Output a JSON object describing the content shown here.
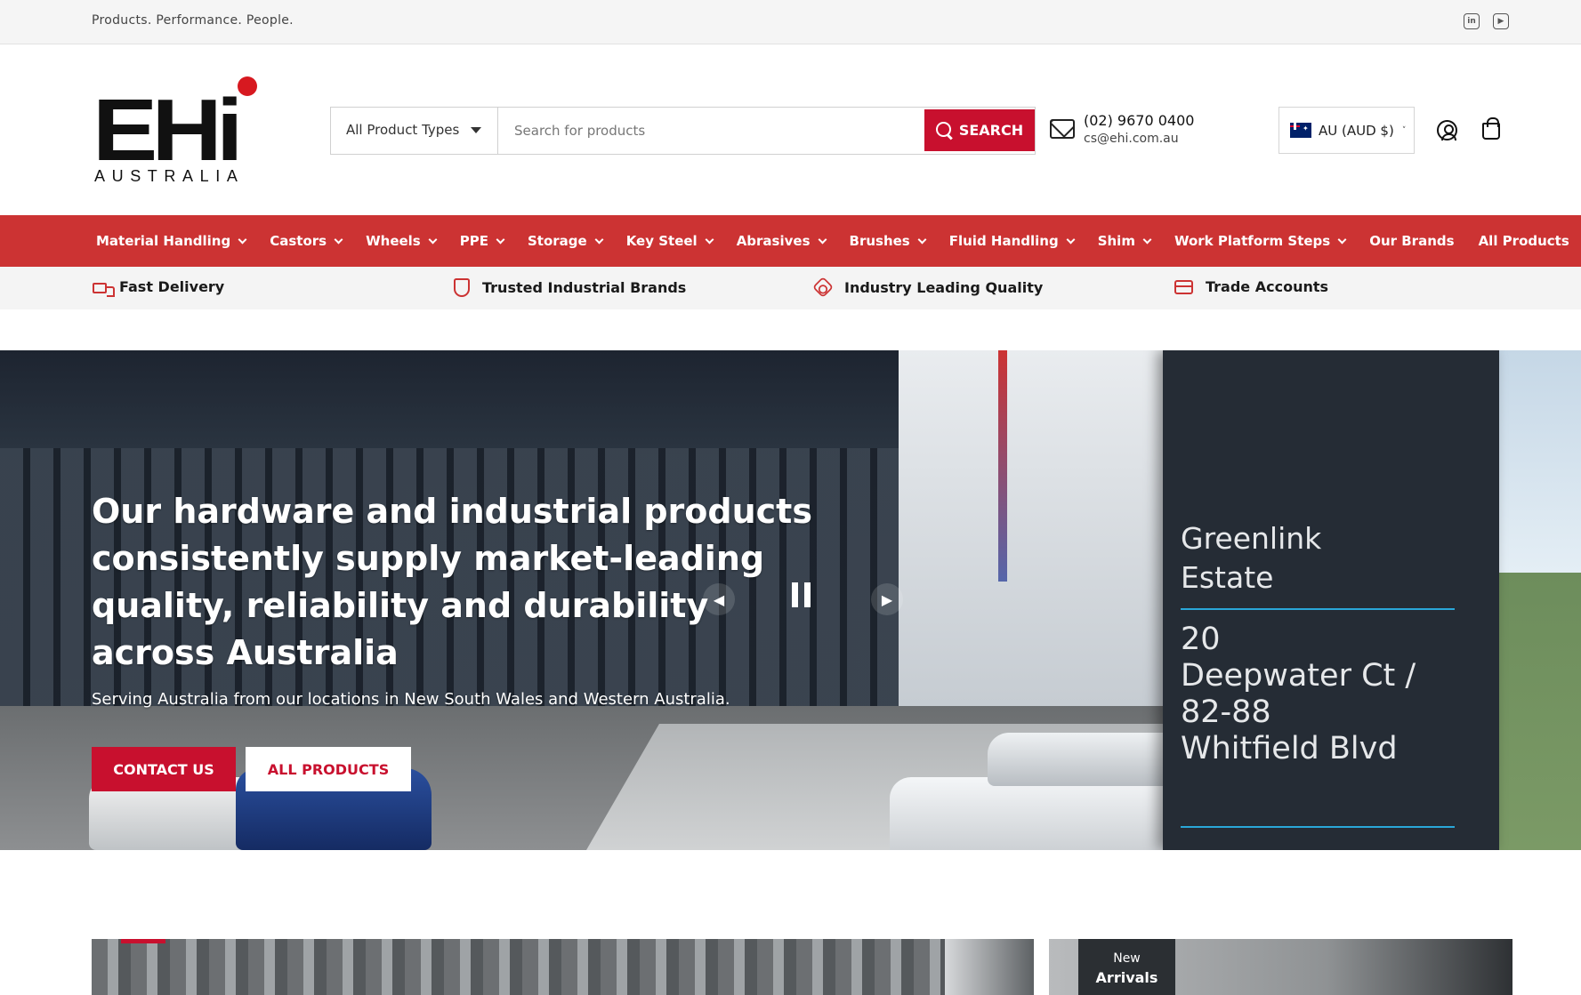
{
  "topbar": {
    "tagline": "Products. Performance. People.",
    "social_icons": [
      "linkedin-icon",
      "youtube-icon"
    ]
  },
  "header": {
    "logo_letters": "EHi",
    "logo_sub": "AUSTRALIA",
    "search": {
      "category_label": "All Product Types",
      "placeholder": "Search for products",
      "button_label": "SEARCH"
    },
    "contact": {
      "phone": "(02) 9670 0400",
      "email": "cs@ehi.com.au"
    },
    "currency": {
      "label": "AU (AUD $)",
      "flag": "australia-flag-icon"
    }
  },
  "nav": {
    "items": [
      {
        "label": "Material Handling",
        "dropdown": true
      },
      {
        "label": "Castors",
        "dropdown": true
      },
      {
        "label": "Wheels",
        "dropdown": true
      },
      {
        "label": "PPE",
        "dropdown": true
      },
      {
        "label": "Storage",
        "dropdown": true
      },
      {
        "label": "Key Steel",
        "dropdown": true
      },
      {
        "label": "Abrasives",
        "dropdown": true
      },
      {
        "label": "Brushes",
        "dropdown": true
      },
      {
        "label": "Fluid Handling",
        "dropdown": true
      },
      {
        "label": "Shim",
        "dropdown": true
      },
      {
        "label": "Work Platform Steps",
        "dropdown": true
      },
      {
        "label": "Our Brands",
        "dropdown": false
      },
      {
        "label": "All Products",
        "dropdown": false
      }
    ]
  },
  "features": [
    {
      "label": "Fast Delivery",
      "icon": "truck-icon"
    },
    {
      "label": "Trusted Industrial Brands",
      "icon": "shield-icon"
    },
    {
      "label": "Industry Leading Quality",
      "icon": "quality-badge-icon"
    },
    {
      "label": "Trade Accounts",
      "icon": "credit-card-icon"
    }
  ],
  "hero": {
    "headline": "Our hardware and industrial products consistently supply market-leading quality, reliability and durability across Australia",
    "subline": "Serving Australia from our locations in New South Wales and Western Australia.",
    "primary_button": "CONTACT US",
    "secondary_button": "ALL PRODUCTS",
    "sign_line1": "Greenlink",
    "sign_line2": "Estate",
    "sign_line3": "20",
    "sign_line4": "Deepwater Ct /",
    "sign_line5": "82-88",
    "sign_line6": "Whitfield Blvd"
  },
  "promo": {
    "badge_line1": "New",
    "badge_line2": "Arrivals"
  },
  "colors": {
    "brand_red": "#c8102e",
    "nav_red": "#cc3333",
    "topbar_bg": "#f5f5f5"
  }
}
